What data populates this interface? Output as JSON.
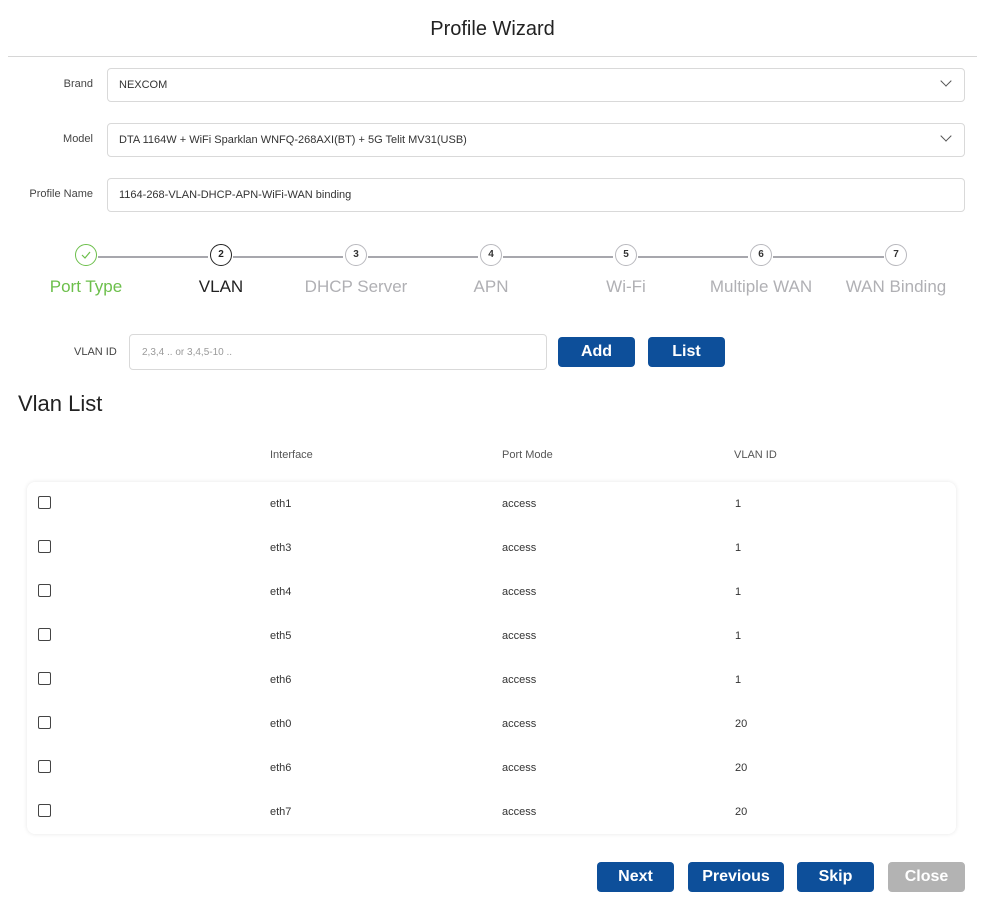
{
  "dialog": {
    "title": "Profile Wizard"
  },
  "form": {
    "brand": {
      "label": "Brand",
      "value": "NEXCOM"
    },
    "model": {
      "label": "Model",
      "value": "DTA 1164W + WiFi Sparklan WNFQ-268AXI(BT) + 5G Telit MV31(USB)"
    },
    "profile_name": {
      "label": "Profile Name",
      "value": "1164-268-VLAN-DHCP-APN-WiFi-WAN binding"
    }
  },
  "steps": [
    {
      "number": "1",
      "label": "Port Type",
      "state": "done"
    },
    {
      "number": "2",
      "label": "VLAN",
      "state": "active"
    },
    {
      "number": "3",
      "label": "DHCP Server",
      "state": "pending"
    },
    {
      "number": "4",
      "label": "APN",
      "state": "pending"
    },
    {
      "number": "5",
      "label": "Wi-Fi",
      "state": "pending"
    },
    {
      "number": "6",
      "label": "Multiple WAN",
      "state": "pending"
    },
    {
      "number": "7",
      "label": "WAN Binding",
      "state": "pending"
    }
  ],
  "vlan_entry": {
    "label": "VLAN ID",
    "placeholder": "2,3,4 .. or 3,4,5-10 ..",
    "add_label": "Add",
    "list_label": "List"
  },
  "vlan_list": {
    "heading": "Vlan List",
    "columns": {
      "interface": "Interface",
      "port_mode": "Port Mode",
      "vlan_id": "VLAN ID"
    },
    "rows": [
      {
        "interface": "eth1",
        "port_mode": "access",
        "vlan_id": "1"
      },
      {
        "interface": "eth3",
        "port_mode": "access",
        "vlan_id": "1"
      },
      {
        "interface": "eth4",
        "port_mode": "access",
        "vlan_id": "1"
      },
      {
        "interface": "eth5",
        "port_mode": "access",
        "vlan_id": "1"
      },
      {
        "interface": "eth6",
        "port_mode": "access",
        "vlan_id": "1"
      },
      {
        "interface": "eth0",
        "port_mode": "access",
        "vlan_id": "20"
      },
      {
        "interface": "eth6",
        "port_mode": "access",
        "vlan_id": "20"
      },
      {
        "interface": "eth7",
        "port_mode": "access",
        "vlan_id": "20"
      }
    ]
  },
  "footer": {
    "next_label": "Next",
    "previous_label": "Previous",
    "skip_label": "Skip",
    "close_label": "Close"
  },
  "colors": {
    "primary": "#0d4f9a",
    "done": "#6cbf4b",
    "disabled": "#b3b3b3"
  },
  "icons": {
    "brand_dropdown": "chevron-down-icon",
    "model_dropdown": "chevron-down-icon",
    "step_done": "check-icon"
  }
}
